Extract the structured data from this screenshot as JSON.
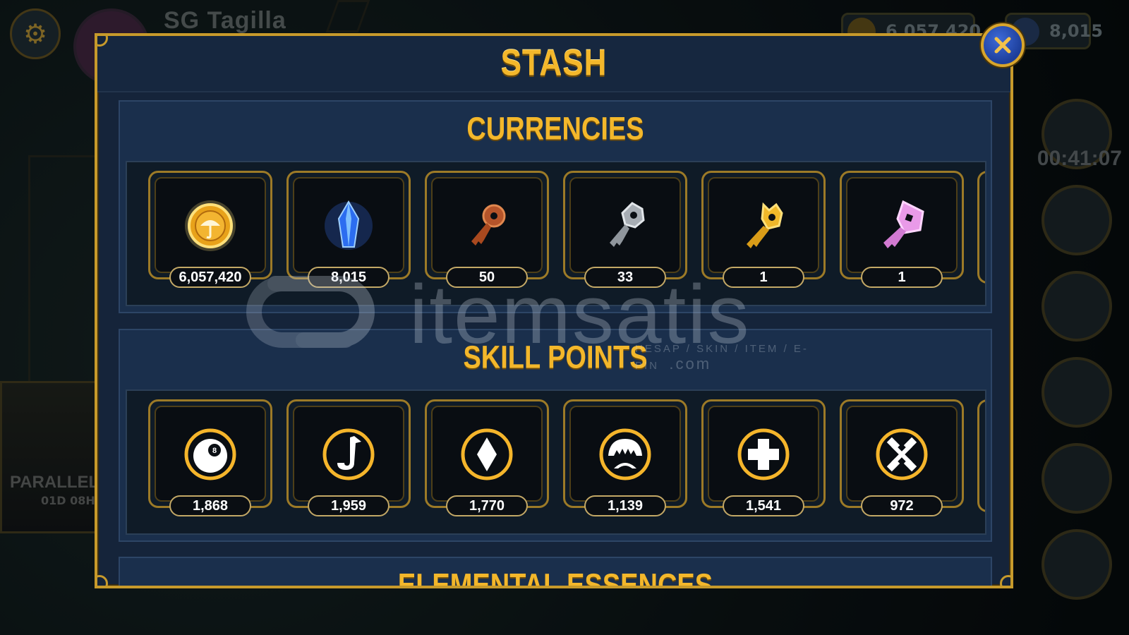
{
  "hud": {
    "player_name": "SG Tagilla",
    "gold": "6,057,420",
    "gems": "8,015",
    "timer": "00:41:07",
    "event_title": "PARALLEL",
    "event_time": "01D 08H"
  },
  "window": {
    "title": "STASH",
    "close_label": "✕"
  },
  "sections": [
    {
      "title": "CURRENCIES",
      "items": [
        {
          "icon": "coin-icon",
          "value": "6,057,420"
        },
        {
          "icon": "crystal-icon",
          "value": "8,015"
        },
        {
          "icon": "bronze-key-icon",
          "value": "50"
        },
        {
          "icon": "silver-key-icon",
          "value": "33"
        },
        {
          "icon": "gold-key-icon",
          "value": "1"
        },
        {
          "icon": "pink-key-icon",
          "value": "1"
        }
      ]
    },
    {
      "title": "SKILL POINTS",
      "items": [
        {
          "icon": "bomb-icon",
          "value": "1,868"
        },
        {
          "icon": "saxophone-icon",
          "value": "1,959"
        },
        {
          "icon": "diamond-icon",
          "value": "1,770"
        },
        {
          "icon": "jaw-icon",
          "value": "1,139"
        },
        {
          "icon": "cross-icon",
          "value": "1,541"
        },
        {
          "icon": "hammers-icon",
          "value": "972"
        }
      ]
    },
    {
      "title": "ELEMENTAL ESSENCES",
      "items": []
    }
  ],
  "watermark": {
    "text": "itemsatis",
    "sub": "HESAP / SKIN / ITEM / E-PIN",
    "dotcom": ".com"
  },
  "colors": {
    "gold": "#f3b72b",
    "frame": "#c79a2b",
    "panel": "#15243a"
  }
}
